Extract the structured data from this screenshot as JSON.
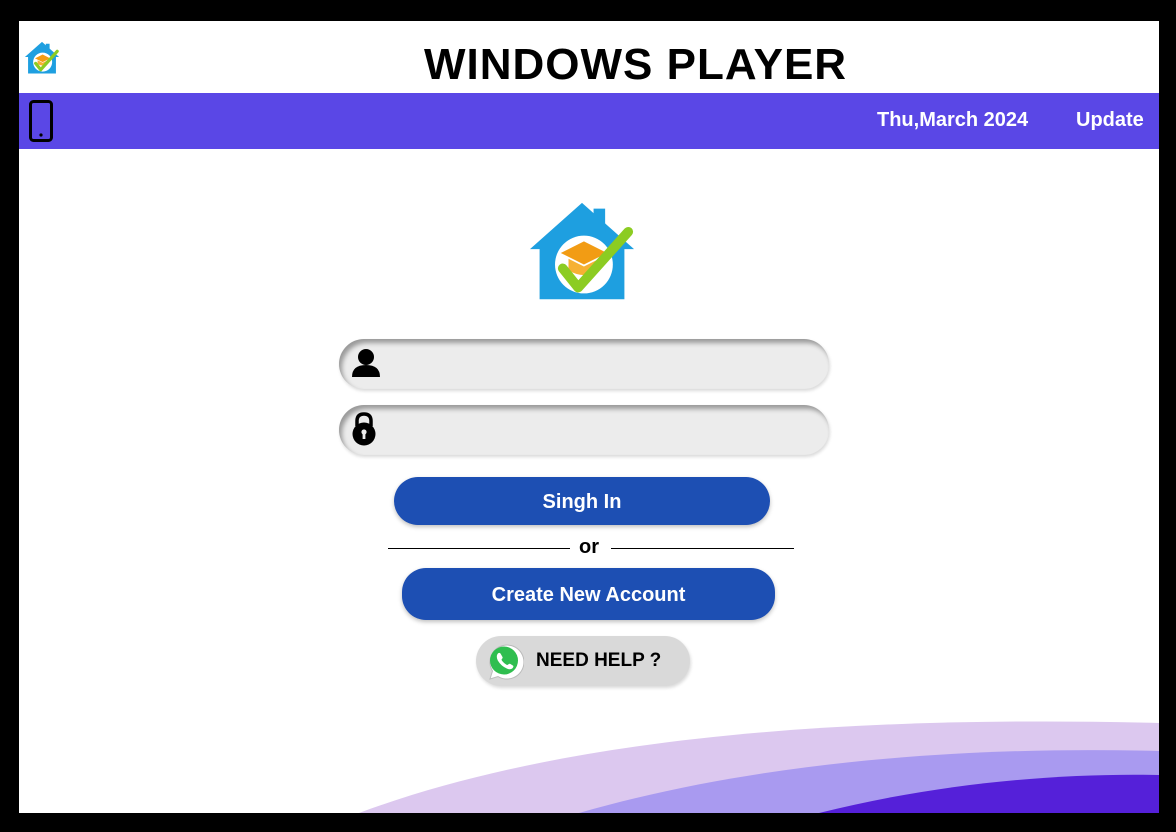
{
  "header": {
    "title": "WINDOWS  PLAYER",
    "logo_icon": "house-graduation-logo-icon"
  },
  "navbar": {
    "device_icon": "smartphone-icon",
    "date": "Thu,March 2024",
    "update_label": "Update",
    "background": "#5a47e6"
  },
  "login": {
    "username_icon": "user-icon",
    "password_icon": "lock-icon",
    "username_value": "",
    "password_value": "",
    "signin_label": "Singh In",
    "or_label": "or",
    "create_label": "Create New Account",
    "help_label": "NEED HELP ?",
    "help_icon": "whatsapp-icon",
    "button_color": "#1d4fb3"
  }
}
